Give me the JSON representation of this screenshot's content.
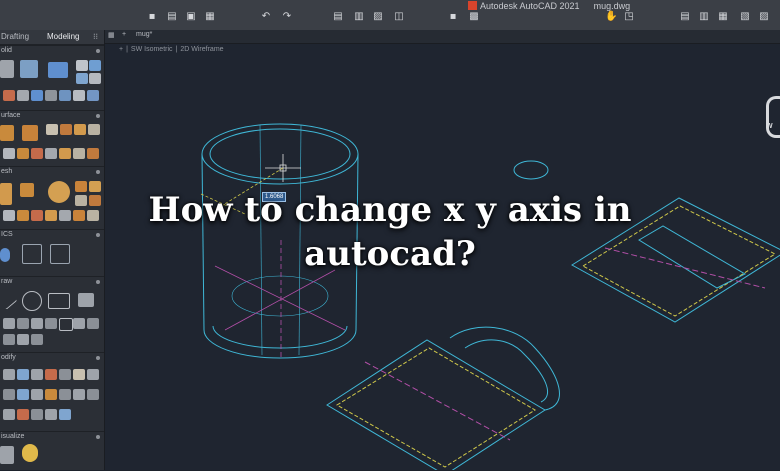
{
  "app": {
    "title": "Autodesk AutoCAD 2021",
    "file": "mug.dwg"
  },
  "palette": {
    "tabs": [
      "Drafting",
      "Modeling"
    ],
    "active_tab": "Modeling",
    "sections": [
      "olid",
      "urface",
      "esh",
      "ICS",
      "raw",
      "odify",
      "isualize"
    ]
  },
  "canvas": {
    "tab": "mug*",
    "view": "SW Isometric",
    "style": "2D Wireframe",
    "dimension_value": "1.6068",
    "viewcube_label": "W"
  },
  "overlay": {
    "line1": "How to change x y axis in",
    "line2": "autocad?"
  },
  "colors": {
    "drawing_cyan": "#3fb7d6",
    "drawing_yellow": "#cfc84a",
    "drawing_magenta": "#b34fa8",
    "dimension_bg": "#2e5a8c"
  }
}
